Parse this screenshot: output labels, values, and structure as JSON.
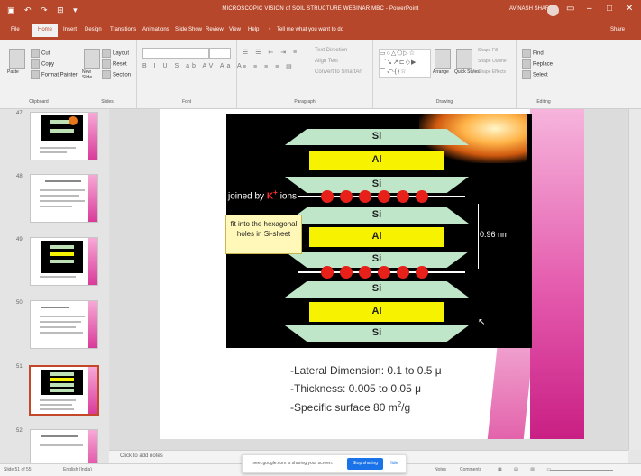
{
  "window": {
    "title": "MICROSCOPIC VISION of SOIL STRUCTURE WEBINAR MBC - PowerPoint",
    "user": "AVINASH SHAR...",
    "quick_access": "▣ ↶ ↷ ⊞ ▾",
    "min": "–",
    "max": "□",
    "close": "✕"
  },
  "tabs": [
    "File",
    "Home",
    "Insert",
    "Design",
    "Transitions",
    "Animations",
    "Slide Show",
    "Review",
    "View",
    "Help",
    "Tell me what you want to do"
  ],
  "tabs_right": "Share",
  "ribbon": {
    "clipboard": {
      "label": "Clipboard",
      "paste": "Paste",
      "cut": "Cut",
      "copy": "Copy",
      "format_painter": "Format Painter"
    },
    "slides": {
      "label": "Slides",
      "new_slide": "New Slide",
      "layout": "Layout",
      "reset": "Reset",
      "section": "Section"
    },
    "font": {
      "label": "Font"
    },
    "paragraph": {
      "label": "Paragraph",
      "text_direction": "Text Direction",
      "align_text": "Align Text",
      "convert": "Convert to SmartArt"
    },
    "drawing": {
      "label": "Drawing",
      "arrange": "Arrange",
      "quick_styles": "Quick Styles",
      "shape_fill": "Shape Fill",
      "shape_outline": "Shape Outline",
      "shape_effects": "Shape Effects"
    },
    "editing": {
      "label": "Editing",
      "find": "Find",
      "replace": "Replace",
      "select": "Select"
    }
  },
  "slide_numbers": [
    "47",
    "48",
    "49",
    "50",
    "51",
    "52"
  ],
  "slide": {
    "layers": [
      {
        "kind": "Si",
        "label": "Si"
      },
      {
        "kind": "Al",
        "label": "Al"
      },
      {
        "kind": "Si",
        "label": "Si"
      },
      {
        "kind": "Si",
        "label": "Si"
      },
      {
        "kind": "Al",
        "label": "Al"
      },
      {
        "kind": "Si",
        "label": "Si"
      },
      {
        "kind": "Si",
        "label": "Si"
      },
      {
        "kind": "Al",
        "label": "Al"
      },
      {
        "kind": "Si",
        "label": "Si"
      }
    ],
    "joined_prefix": "joined by ",
    "joined_ion": "K",
    "joined_sup": "+",
    "joined_suffix": " ions",
    "callout_line1": "fit into the hexagonal",
    "callout_line2": "holes in Si-sheet",
    "dimension": "0.96 nm",
    "bullets": [
      "-Lateral Dimension: 0.1 to 0.5 μ",
      "-Thickness: 0.005 to 0.05 μ"
    ],
    "bullet3_prefix": "-Specific surface 80 m",
    "bullet3_sup": "2",
    "bullet3_suffix": "/g",
    "colors": {
      "si": "#bfe6c9",
      "al": "#f7f200",
      "k_ion": "#e8201a",
      "background": "#000000"
    }
  },
  "notes_placeholder": "Click to add notes",
  "share_bar": {
    "message": "meet.google.com is sharing your screen.",
    "stop": "Stop sharing",
    "hide": "Hide"
  },
  "status": {
    "slide_of": "Slide 51 of 55",
    "language": "English (India)",
    "notes": "Notes",
    "comments": "Comments"
  }
}
